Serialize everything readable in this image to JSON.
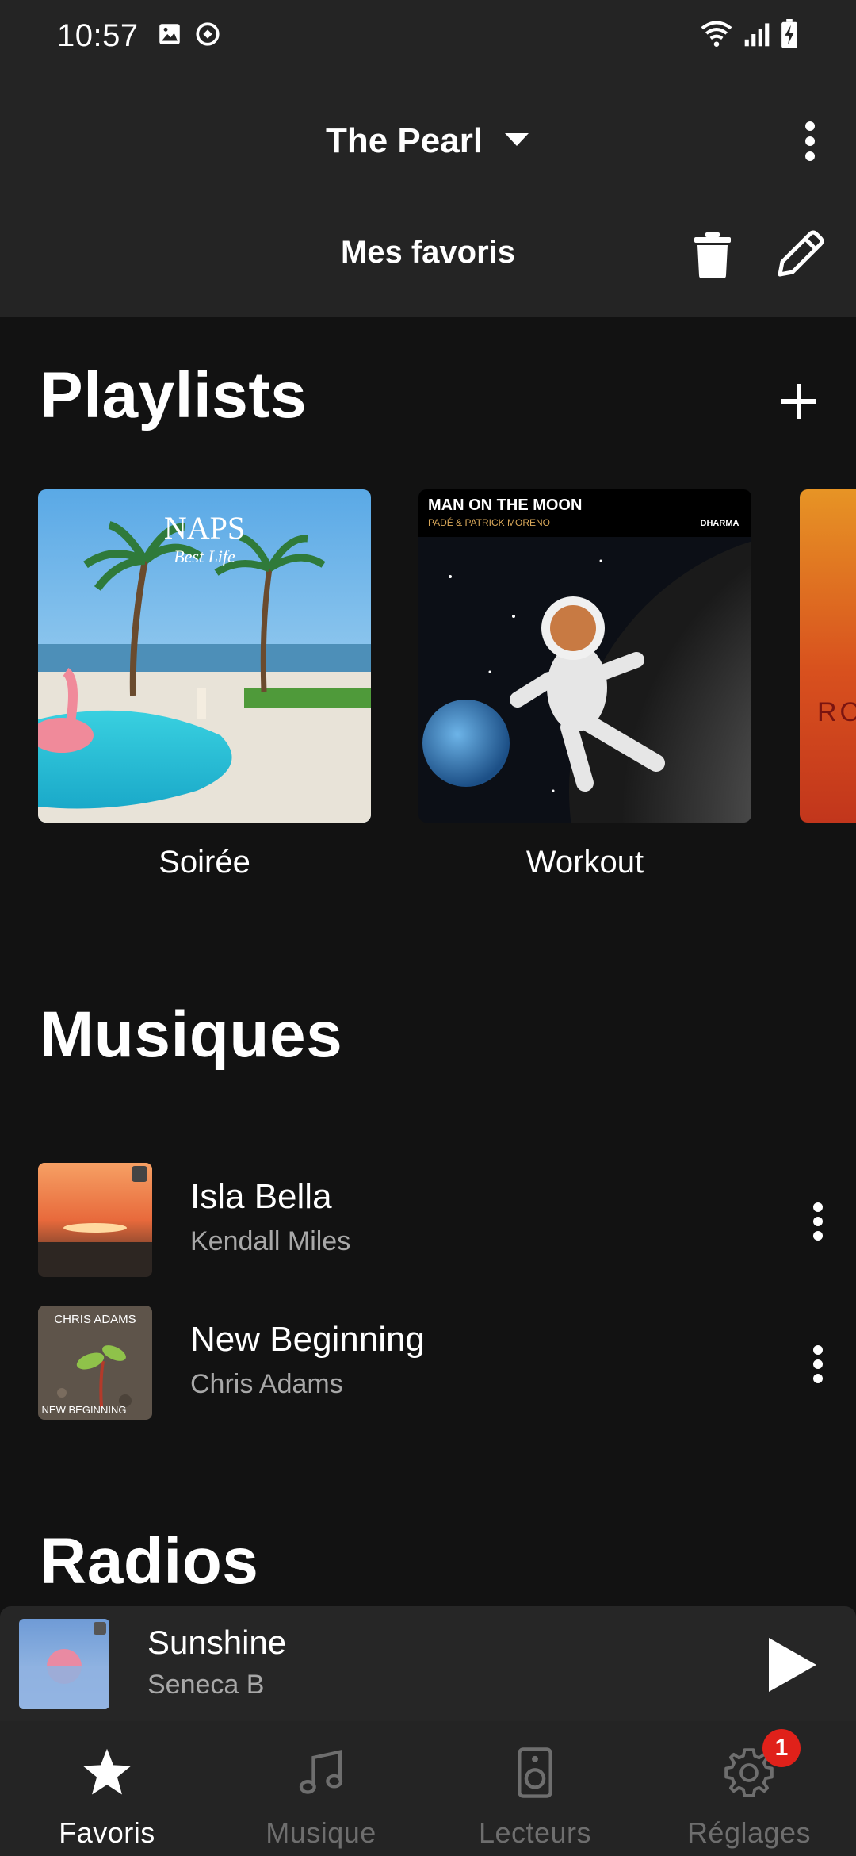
{
  "status_bar": {
    "time": "10:57",
    "icons": [
      "image-icon",
      "sync-icon",
      "wifi-icon",
      "signal-icon",
      "battery-charging-icon"
    ]
  },
  "header": {
    "device_name": "The Pearl",
    "subtitle": "Mes favoris"
  },
  "playlists_section": {
    "title": "Playlists",
    "items": [
      {
        "label": "Soirée",
        "cover_text": "NAPS",
        "cover_subtext": "Best Life"
      },
      {
        "label": "Workout",
        "cover_text": "MAN ON THE MOON",
        "cover_subtext": "PADÉ & PATRICK MORENO",
        "cover_brand": "DHARMA"
      },
      {
        "label": "",
        "cover_text": "RO"
      }
    ]
  },
  "songs_section": {
    "title": "Musiques",
    "items": [
      {
        "title": "Isla Bella",
        "artist": "Kendall Miles"
      },
      {
        "title": "New Beginning",
        "artist": "Chris Adams",
        "cover_text_top": "CHRIS ADAMS",
        "cover_text_bottom": "NEW BEGINNING"
      }
    ]
  },
  "radios_section": {
    "title": "Radios"
  },
  "mini_player": {
    "title": "Sunshine",
    "artist": "Seneca B"
  },
  "bottom_nav": {
    "items": [
      {
        "label": "Favoris",
        "icon": "star-icon",
        "active": true
      },
      {
        "label": "Musique",
        "icon": "music-note-icon",
        "active": false
      },
      {
        "label": "Lecteurs",
        "icon": "speaker-icon",
        "active": false
      },
      {
        "label": "Réglages",
        "icon": "gear-icon",
        "active": false,
        "badge": "1"
      }
    ]
  },
  "colors": {
    "background": "#121212",
    "header": "#242424",
    "badge": "#e0211a",
    "secondary_text": "#a8a8a8",
    "inactive_nav": "#6e6e6e"
  }
}
